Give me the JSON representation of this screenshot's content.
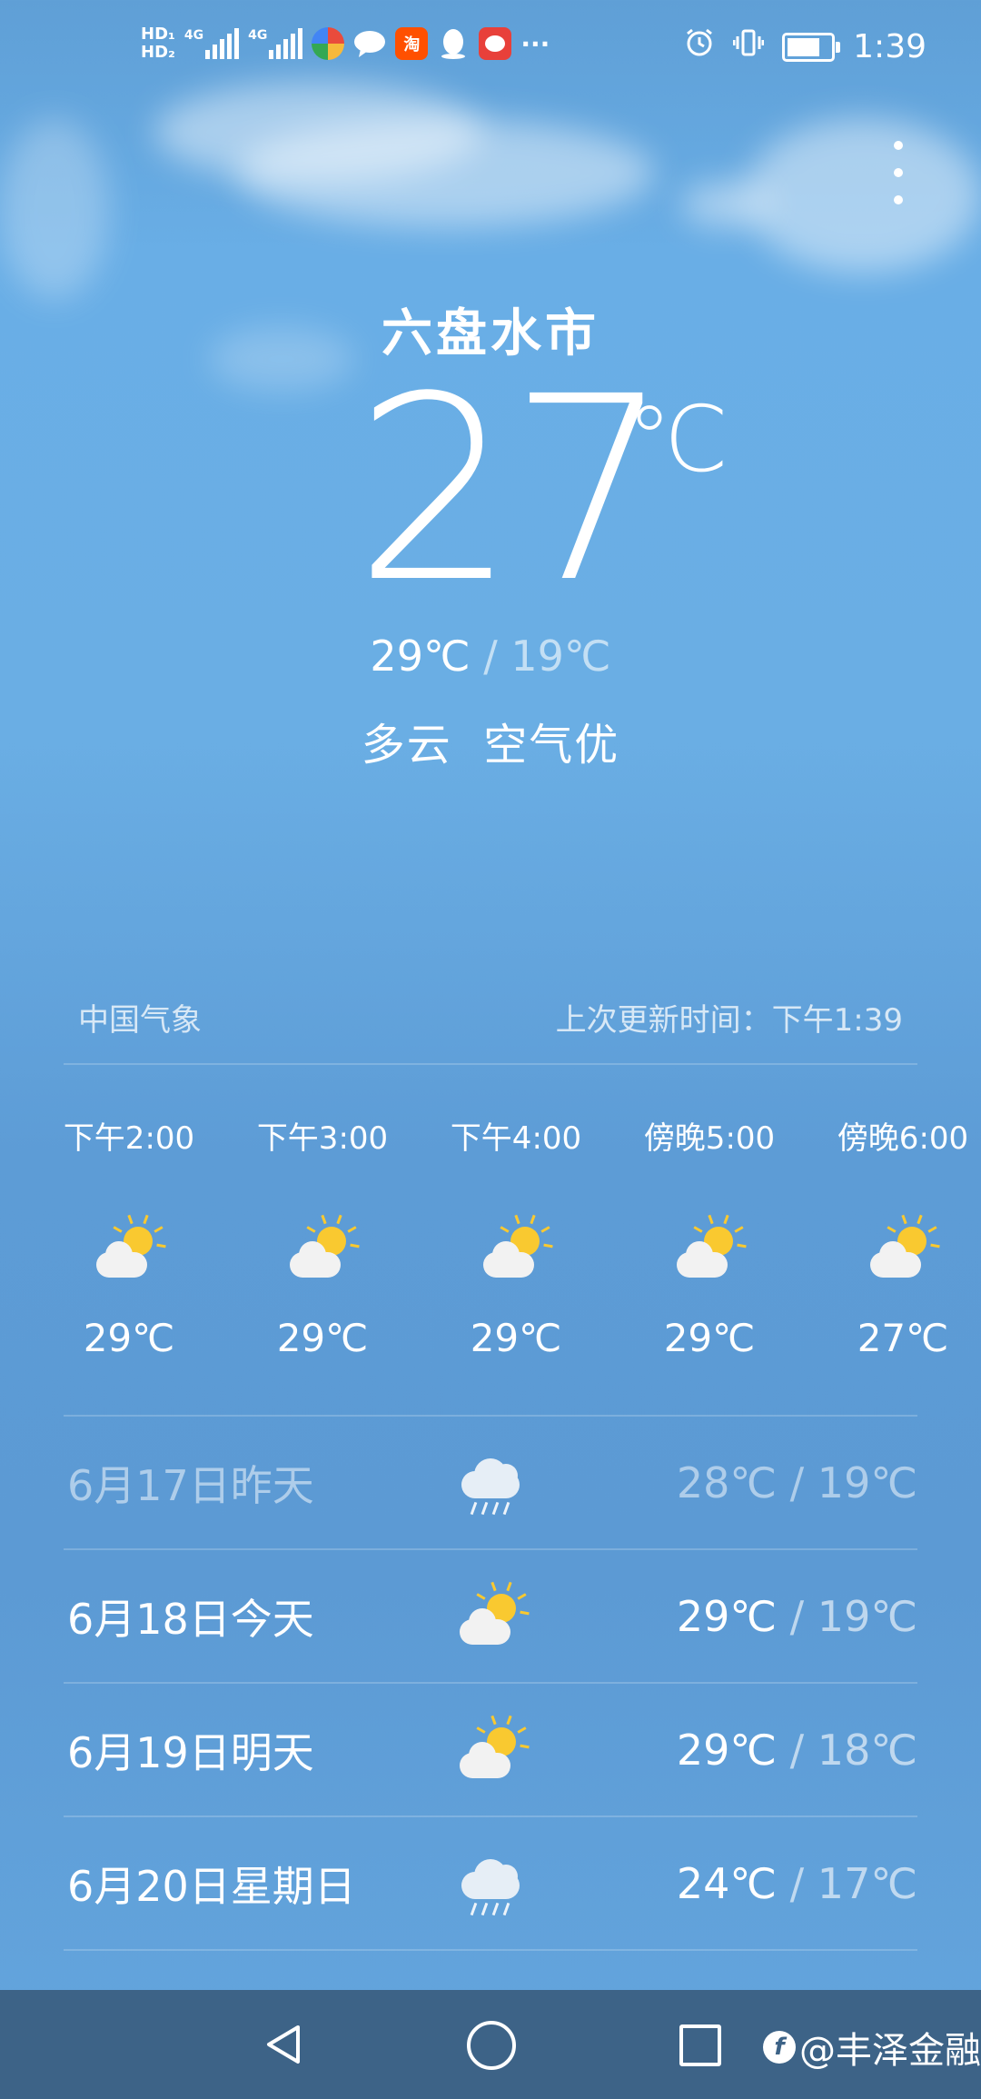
{
  "status_bar": {
    "sim1": "HD₁",
    "sim2": "HD₂",
    "net1": "4G",
    "net2": "4G",
    "app_taobao": "淘",
    "overflow": "···",
    "time": "1:39",
    "battery_level": 0.75,
    "icons": [
      "hd-icon",
      "signal-icon",
      "signal-icon",
      "pinwheel-app-icon",
      "message-icon",
      "taobao-icon",
      "qq-icon",
      "app-icon",
      "alarm-icon",
      "vibrate-icon",
      "battery-icon"
    ]
  },
  "weather": {
    "city": "六盘水市",
    "temperature": "27",
    "unit": "℃",
    "high": "29℃",
    "sep": "/",
    "low": "19℃",
    "condition": "多云",
    "air": "空气优"
  },
  "source": {
    "provider": "中国气象",
    "updated": "上次更新时间：下午1:39"
  },
  "hourly": [
    {
      "time": "下午2:00",
      "temp": "29℃",
      "icon": "partly-cloudy-icon"
    },
    {
      "time": "下午3:00",
      "temp": "29℃",
      "icon": "partly-cloudy-icon"
    },
    {
      "time": "下午4:00",
      "temp": "29℃",
      "icon": "partly-cloudy-icon"
    },
    {
      "time": "傍晚5:00",
      "temp": "29℃",
      "icon": "partly-cloudy-icon"
    },
    {
      "time": "傍晚6:00",
      "temp": "27℃",
      "icon": "partly-cloudy-icon"
    }
  ],
  "daily": [
    {
      "date": "6月17日昨天",
      "high": "28℃",
      "sep": "/",
      "low": "19℃",
      "icon": "rain-icon"
    },
    {
      "date": "6月18日今天",
      "high": "29℃",
      "sep": "/",
      "low": "19℃",
      "icon": "partly-cloudy-icon"
    },
    {
      "date": "6月19日明天",
      "high": "29℃",
      "sep": "/",
      "low": "18℃",
      "icon": "partly-cloudy-icon"
    },
    {
      "date": "6月20日星期日",
      "high": "24℃",
      "sep": "/",
      "low": "17℃",
      "icon": "rain-icon"
    }
  ],
  "watermark": "@丰泽金融",
  "colors": {
    "sky": "#66a9e0",
    "navbar": "#3d6387",
    "sun": "#f9c930"
  }
}
